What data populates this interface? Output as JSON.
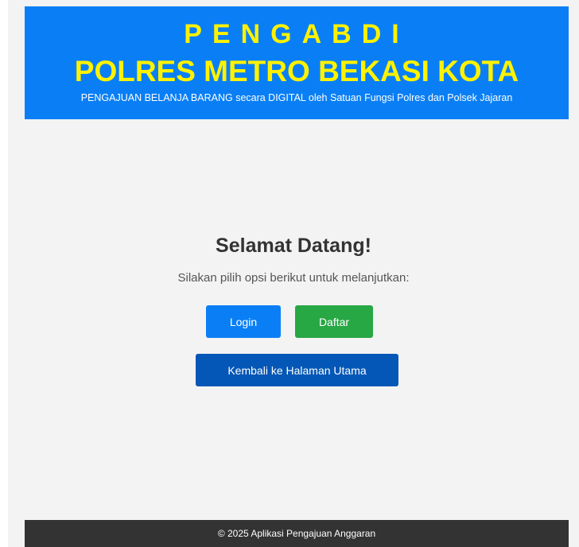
{
  "header": {
    "title_top": "PENGABDI",
    "title_main": "POLRES METRO BEKASI KOTA",
    "subtitle": "PENGAJUAN BELANJA BARANG secara DIGITAL oleh Satuan Fungsi Polres dan Polsek Jajaran"
  },
  "main": {
    "heading": "Selamat Datang!",
    "instruction": "Silakan pilih opsi berikut untuk melanjutkan:",
    "login_label": "Login",
    "daftar_label": "Daftar",
    "home_label": "Kembali ke Halaman Utama"
  },
  "footer": {
    "text": "© 2025 Aplikasi Pengajuan Anggaran"
  },
  "colors": {
    "header_bg": "#0a7ff5",
    "title_color": "#fff200",
    "login_bg": "#0a7ff5",
    "daftar_bg": "#28a745",
    "home_bg": "#0457b6",
    "footer_bg": "#333333",
    "page_bg": "#f3f3f3"
  }
}
